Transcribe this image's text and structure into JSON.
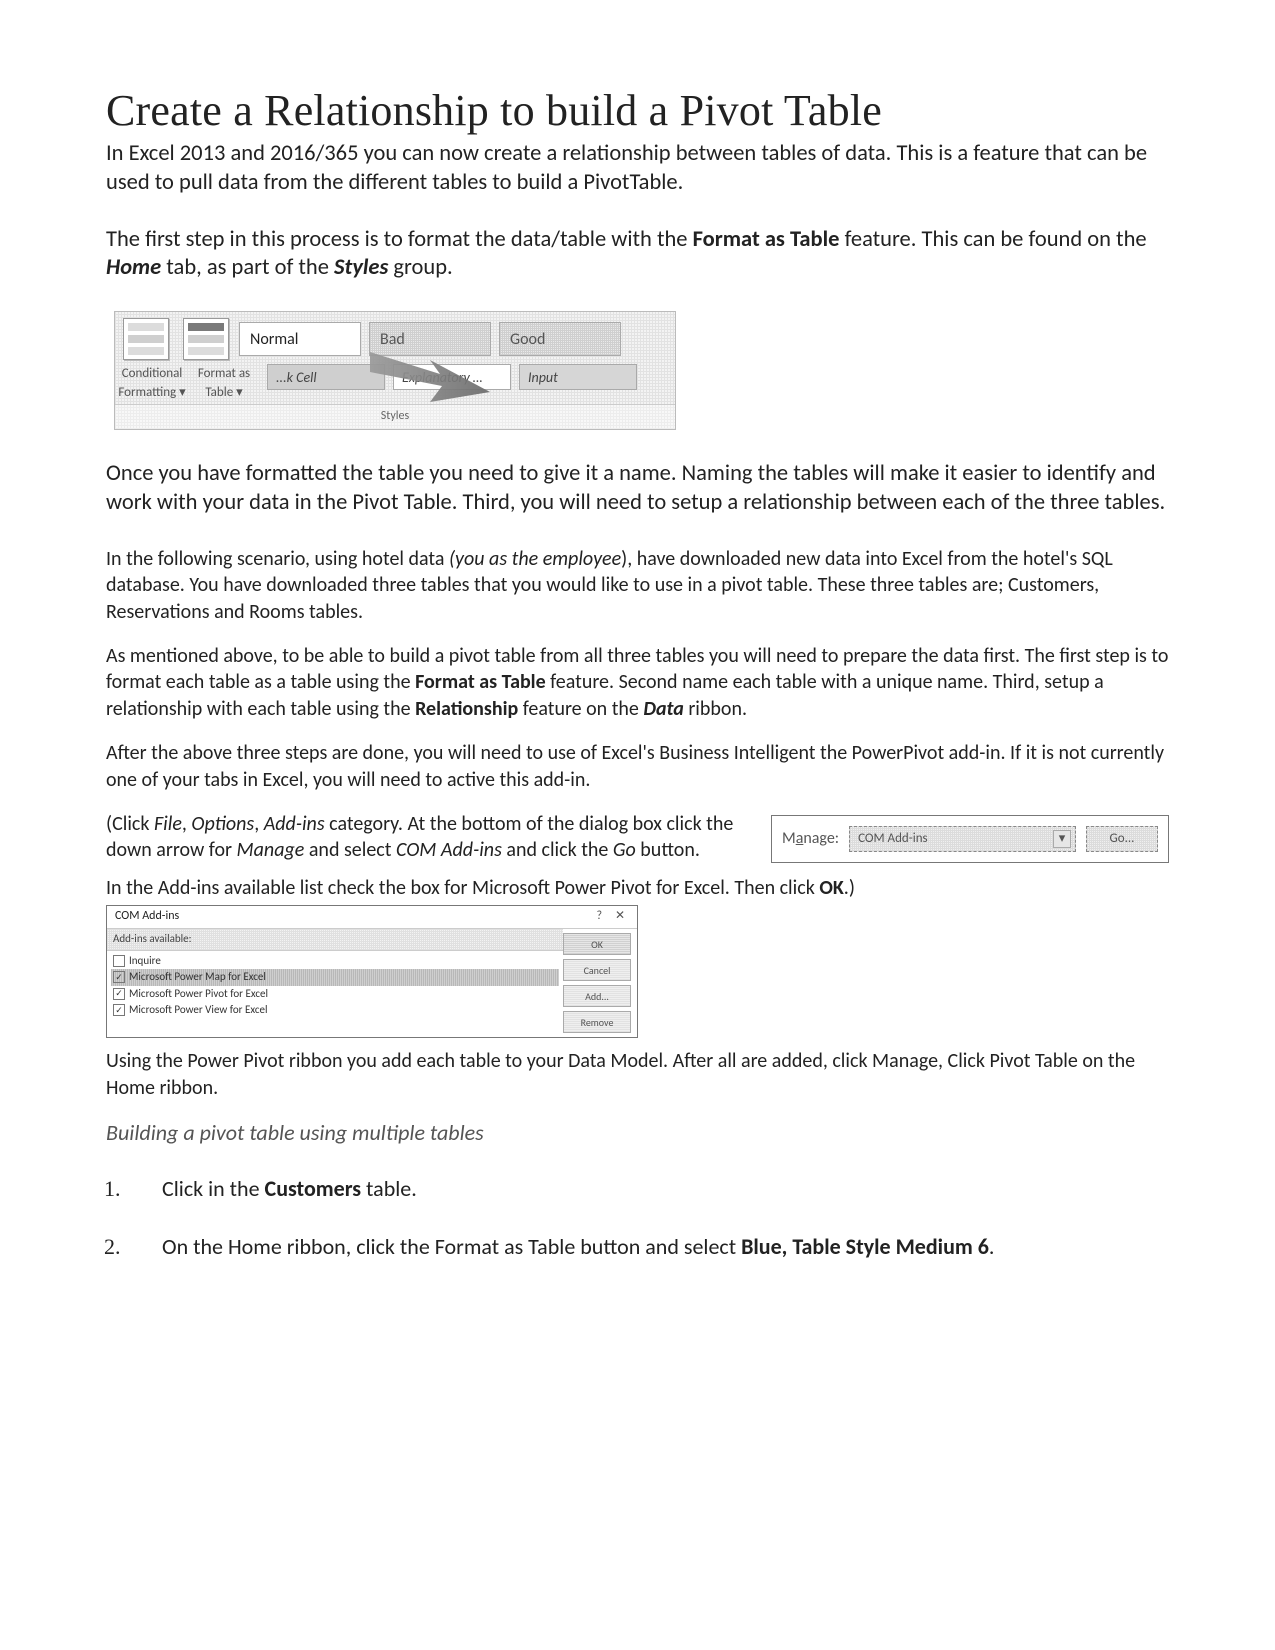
{
  "title": "Create a Relationship to build a Pivot Table",
  "p_intro_pre": "In Excel 2013 and 2016/365 you can now create a relationship between tables of data. This is a feature that can be used to pull data from the different tables to build a PivotTable.",
  "p_step1_a": "The first step in this process is to format the data/table with the ",
  "p_step1_fat": "Format as Table",
  "p_step1_b": " feature. This can be found on the ",
  "p_step1_home": "Home",
  "p_step1_c": " tab, as part of the ",
  "p_step1_styles": "Styles",
  "p_step1_d": " group.",
  "fig_styles": {
    "btn_cf_a": "Conditional",
    "btn_cf_b": "Formatting ▾",
    "btn_fat_a": "Format as",
    "btn_fat_b": "Table ▾",
    "cell_normal": "Normal",
    "cell_bad": "Bad",
    "cell_good": "Good",
    "cell_check": "...k Cell",
    "cell_explan": "Explanatory …",
    "cell_input": "Input",
    "footer": "Styles"
  },
  "p_after_styles": "Once you have formatted the table you need to give it a name. Naming the tables will make it easier to identify and work with your data in the Pivot Table. Third, you will need to setup a relationship between each of the three tables.",
  "p_scenario_a": "In the following scenario, using hotel data ",
  "p_scenario_paren": "(you as the employee",
  "p_scenario_b": "), have downloaded new data  into Excel from the hotel's SQL database. You have downloaded three tables that you would like to use in a pivot table. These three tables are; Customers, Reservations and Rooms tables.",
  "p_prep_a": "As mentioned above, to be able to build a pivot table from all three tables you will need to prepare the data first. The first step is to format each table as a table using the ",
  "p_prep_fat": "Format as Table",
  "p_prep_b": " feature. Second name each table with a unique name. Third, setup a relationship with each table using the ",
  "p_prep_rel": "Relationship",
  "p_prep_c": " feature on the ",
  "p_prep_data": "Data",
  "p_prep_d": " ribbon.",
  "p_pp_a": "After the above three steps are done, you will need to use of Excel's Business Intelligent the PowerPivot add-in. If it is not currently one of your tabs in Excel, you will need to active this add-in.",
  "p_click_a": "(Click ",
  "p_click_file": "File",
  "p_click_b": ", ",
  "p_click_opt": "Options",
  "p_click_c": ", ",
  "p_click_addins": "Add-ins",
  "p_click_d": " category. At the bottom of the dialog box click the down arrow for ",
  "p_click_manage": "Manage",
  "p_click_e": " and select ",
  "p_click_com": "COM Add-ins",
  "p_click_f": " and click the ",
  "p_click_go": "Go",
  "p_click_g": " button.",
  "fig_manage": {
    "label_pre": "M",
    "label_u": "a",
    "label_post": "nage:",
    "combo": "COM Add-ins",
    "go": "Go..."
  },
  "p_addins_a": "In the Add-ins available list check the box for Microsoft Power Pivot for Excel. Then click ",
  "p_addins_ok": "OK",
  "p_addins_b": ".)",
  "fig_addins": {
    "title": "COM Add-ins",
    "help": "?",
    "close": "✕",
    "sub": "Add-ins available:",
    "it1": "Inquire",
    "it2": "Microsoft Power Map for Excel",
    "it3": "Microsoft Power Pivot for Excel",
    "it4": "Microsoft Power View for Excel",
    "btn_ok": "OK",
    "btn_cancel": "Cancel",
    "btn_add": "Add...",
    "btn_remove": "Remove"
  },
  "p_using_pp": "Using the Power Pivot ribbon you add each table to your Data Model. After all are added, click Manage, Click Pivot Table on the Home ribbon.",
  "section_head": "Building a pivot table using multiple tables",
  "steps": {
    "s1_a": "Click in the ",
    "s1_cust": "Customers",
    "s1_b": " table.",
    "s2_a": "On the Home ribbon, click the Format as Table button and select ",
    "s2_bold": "Blue, Table Style Medium 6",
    "s2_b": "."
  }
}
